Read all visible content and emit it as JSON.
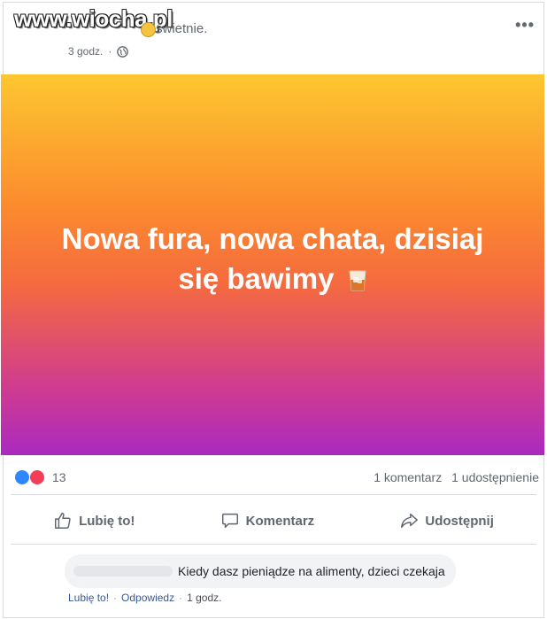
{
  "header": {
    "watermark": "www.wiocha.pl",
    "status": "świetnie.",
    "time": "3 godz.",
    "more_label": "•••"
  },
  "post": {
    "text_line1": "Nowa fura, nowa chata, dzisiaj",
    "text_line2": "się bawimy",
    "gradient_top": "#fdc730",
    "gradient_bottom": "#aa2ac0"
  },
  "stats": {
    "reactions_count": "13",
    "comments": "1 komentarz",
    "shares": "1 udostępnienie"
  },
  "actions": {
    "like": "Lubię to!",
    "comment": "Komentarz",
    "share": "Udostępnij"
  },
  "comment": {
    "text": "Kiedy dasz pieniądze na alimenty, dzieci czekaja",
    "like": "Lubię to!",
    "reply": "Odpowiedz",
    "time": "1 godz."
  },
  "colors": {
    "like_blue": "#2d88ff",
    "love_red": "#f33e58",
    "link": "#385898"
  }
}
